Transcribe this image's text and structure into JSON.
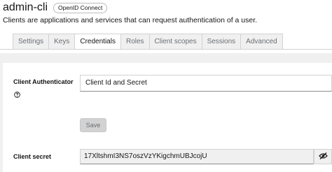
{
  "header": {
    "title": "admin-cli",
    "badge": "OpenID Connect",
    "subtitle": "Clients are applications and services that can request authentication of a user."
  },
  "tabs": [
    {
      "label": "Settings",
      "active": false
    },
    {
      "label": "Keys",
      "active": false
    },
    {
      "label": "Credentials",
      "active": true
    },
    {
      "label": "Roles",
      "active": false
    },
    {
      "label": "Client scopes",
      "active": false
    },
    {
      "label": "Sessions",
      "active": false
    },
    {
      "label": "Advanced",
      "active": false
    }
  ],
  "credentials": {
    "authenticator_label": "Client Authenticator",
    "authenticator_value": "Client Id and Secret",
    "help_icon": "question-circle-icon",
    "save_label": "Save",
    "secret_label": "Client secret",
    "secret_value": "17XltshmI3NS7oszVzYKigchmUBJcojU",
    "toggle_icon": "eye-slash-icon"
  },
  "colors": {
    "panel_bg": "#f0f0f0",
    "text": "#151515",
    "muted": "#6a6e73",
    "border": "#d2d2d2"
  }
}
